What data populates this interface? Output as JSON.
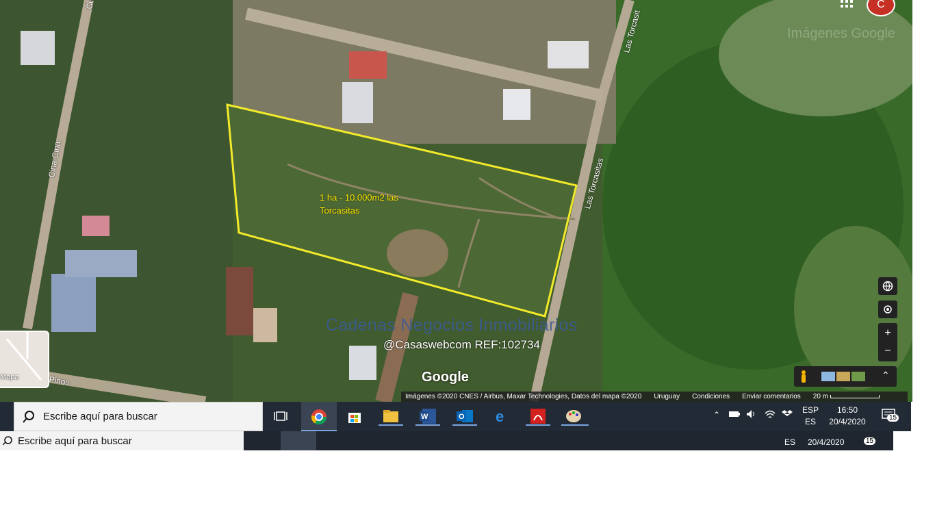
{
  "map": {
    "plot_label_line1": "1 ha - 10.000m2 las",
    "plot_label_line2": "Torcasitas",
    "watermark_company": "Cadenas Negocios Inmobiliarios",
    "watermark_ref": "@Casaswebcom REF:102734",
    "google_logo": "Google",
    "ghost_google": "Imágenes Google",
    "streets": {
      "las_torcasitas_top": "Las Torcasit",
      "las_torcasitas_mid": "Las Torcasitas",
      "cina_cina": "Cina-Cina",
      "pinos": "Pinos",
      "top_left": "Ci"
    },
    "mapcard_label": "Mapa",
    "attribution": {
      "imagery": "Imágenes ©2020 CNES / Airbus, Maxar Technologies, Datos del mapa ©2020",
      "country": "Uruguay",
      "terms": "Condiciones",
      "feedback": "Enviar comentarios",
      "scale": "20 m"
    },
    "avatar_letter": "C",
    "accent_yellow": "#ffe600"
  },
  "taskbar": {
    "search_placeholder": "Escribe aquí para buscar",
    "lang_top": "ESP",
    "lang_bottom": "ES",
    "time": "16:50",
    "date": "20/4/2020",
    "notifications": "15"
  },
  "taskbar_ghost": {
    "search_placeholder": "Escribe aquí para buscar",
    "lang": "ES",
    "date": "20/4/2020",
    "notifications": "15"
  }
}
